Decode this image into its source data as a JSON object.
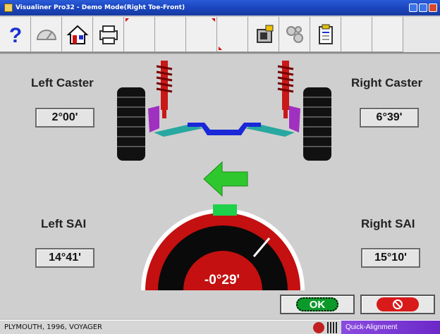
{
  "window": {
    "title": "Visualiner Pro32 - Demo Mode(Right Toe-Front)"
  },
  "toolbar": {
    "buttons": [
      "help-icon",
      "speedometer-icon",
      "home-icon",
      "printer-icon",
      "blank",
      "blank",
      "blank",
      "reverse-icon",
      "settings-gear-icon",
      "notes-icon",
      "blank",
      "blank"
    ]
  },
  "measurements": {
    "left_caster_label": "Left Caster",
    "left_caster_value": "2°00'",
    "right_caster_label": "Right Caster",
    "right_caster_value": "6°39'",
    "left_sai_label": "Left SAI",
    "left_sai_value": "14°41'",
    "right_sai_label": "Right SAI",
    "right_sai_value": "15°10'"
  },
  "gauge": {
    "readout": "-0°29'",
    "colors": {
      "red": "#c41010",
      "black": "#0a0a0a",
      "green": "#1fd04a",
      "needle": "#ffffff"
    }
  },
  "buttons": {
    "ok_label": "OK"
  },
  "status": {
    "vehicle": "PLYMOUTH, 1996, VOYAGER",
    "mode": "Quick-Alignment"
  },
  "colors": {
    "arrow_green": "#2ec82e",
    "axle_blue": "#1a28d8",
    "arm_teal": "#28a8a0",
    "strut_red": "#c81818",
    "knuckle_purple": "#a030c0"
  }
}
